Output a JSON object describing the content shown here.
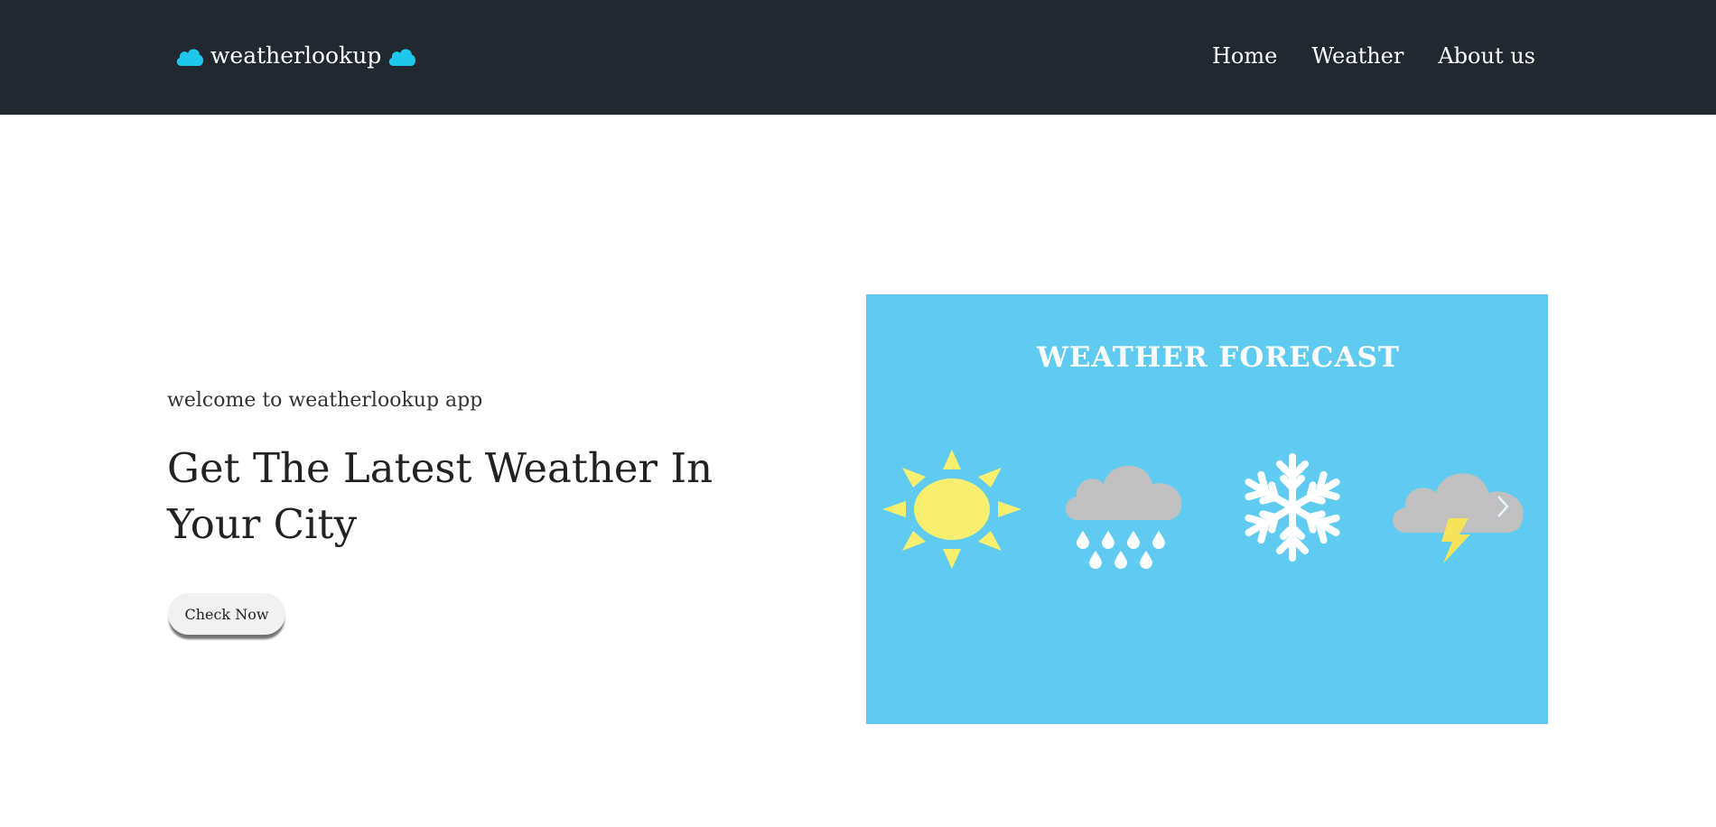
{
  "brand": {
    "name": "weatherlookup",
    "cloud_color": "#1ec8ec"
  },
  "nav": {
    "items": [
      {
        "label": "Home"
      },
      {
        "label": "Weather"
      },
      {
        "label": "About us"
      }
    ]
  },
  "hero": {
    "welcome": "welcome to weatherlookup app",
    "headline": "Get The Latest Weather In Your City",
    "button_label": "Check Now"
  },
  "banner": {
    "title": "WEATHER FORECAST",
    "background": "#5fcbf0",
    "icons": [
      "sun-icon",
      "rain-cloud-icon",
      "snowflake-icon",
      "thunder-cloud-icon"
    ],
    "next_icon": "chevron-right-icon"
  },
  "colors": {
    "navbar": "#212830",
    "sun": "#f8ee70",
    "cloud": "#c0c0c0",
    "bolt": "#f5e35a"
  }
}
